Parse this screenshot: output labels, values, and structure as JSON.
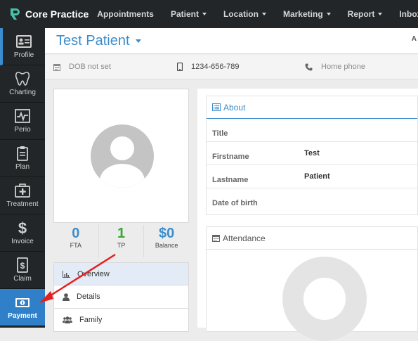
{
  "brand": {
    "name": "Core Practice",
    "accent": "#3c8dcb",
    "logo_color": "#47c1a8"
  },
  "nav": [
    {
      "label": "Appointments",
      "dropdown": false
    },
    {
      "label": "Patient",
      "dropdown": true
    },
    {
      "label": "Location",
      "dropdown": true
    },
    {
      "label": "Marketing",
      "dropdown": true
    },
    {
      "label": "Report",
      "dropdown": true
    },
    {
      "label": "Inbox",
      "dropdown": false
    }
  ],
  "sidebar": {
    "items": [
      {
        "label": "Profile",
        "icon": "id-card-icon"
      },
      {
        "label": "Charting",
        "icon": "tooth-icon"
      },
      {
        "label": "Perio",
        "icon": "pulse-icon"
      },
      {
        "label": "Plan",
        "icon": "clipboard-icon"
      },
      {
        "label": "Treatment",
        "icon": "medical-kit-icon"
      },
      {
        "label": "Invoice",
        "icon": "dollar-icon"
      },
      {
        "label": "Claim",
        "icon": "claim-doc-icon"
      },
      {
        "label": "Payment",
        "icon": "cash-icon"
      }
    ],
    "selected": "Payment"
  },
  "patient": {
    "name": "Test Patient",
    "header_right": "A"
  },
  "info": {
    "dob": "DOB not set",
    "mobile": "1234-656-789",
    "home_phone": "Home phone"
  },
  "stats": [
    {
      "value": "0",
      "label": "FTA",
      "color": "#3c8dcb"
    },
    {
      "value": "1",
      "label": "TP",
      "color": "#3aa635"
    },
    {
      "value": "$0",
      "label": "Balance",
      "color": "#3c8dcb"
    }
  ],
  "menu": [
    {
      "label": "Overview",
      "icon": "chart-icon"
    },
    {
      "label": "Details",
      "icon": "user-icon"
    },
    {
      "label": "Family",
      "icon": "users-icon"
    }
  ],
  "about": {
    "title": "About",
    "rows": [
      {
        "label": "Title",
        "value": ""
      },
      {
        "label": "Firstname",
        "value": "Test"
      },
      {
        "label": "Lastname",
        "value": "Patient"
      },
      {
        "label": "Date of birth",
        "value": ""
      }
    ]
  },
  "attendance": {
    "title": "Attendance"
  },
  "annotation": {
    "arrow_color": "#e41f1f"
  }
}
